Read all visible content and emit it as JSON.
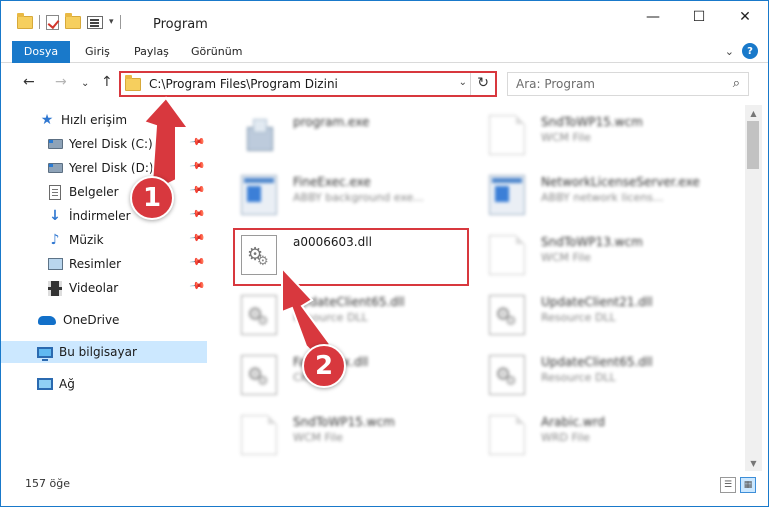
{
  "window": {
    "title": "Program",
    "minimize_glyph": "—",
    "maximize_glyph": "☐",
    "close_glyph": "✕"
  },
  "ribbon": {
    "tabs": [
      {
        "label": "Dosya"
      },
      {
        "label": "Giriş"
      },
      {
        "label": "Paylaş"
      },
      {
        "label": "Görünüm"
      }
    ],
    "expand_glyph": "⌄",
    "help_glyph": "?"
  },
  "nav": {
    "back_glyph": "←",
    "forward_glyph": "→",
    "recent_glyph": "⌄",
    "up_glyph": "↑"
  },
  "address": {
    "path": "C:\\Program Files\\Program Dizini",
    "dropdown_glyph": "⌄",
    "refresh_glyph": "↻"
  },
  "search": {
    "placeholder": "Ara: Program",
    "icon_glyph": "⌕"
  },
  "sidebar": {
    "items": [
      {
        "label": "Hızlı erişim",
        "icon": "star-icon"
      },
      {
        "label": "Yerel Disk (C:)",
        "icon": "disk-icon",
        "pinned": true
      },
      {
        "label": "Yerel Disk (D:)",
        "icon": "disk-icon",
        "pinned": true
      },
      {
        "label": "Belgeler",
        "icon": "document-icon",
        "pinned": true
      },
      {
        "label": "İndirmeler",
        "icon": "download-icon",
        "pinned": true
      },
      {
        "label": "Müzik",
        "icon": "music-icon",
        "pinned": true
      },
      {
        "label": "Resimler",
        "icon": "pictures-icon",
        "pinned": true
      },
      {
        "label": "Videolar",
        "icon": "video-icon",
        "pinned": true
      },
      {
        "label": "OneDrive",
        "icon": "cloud-icon"
      },
      {
        "label": "Bu bilgisayar",
        "icon": "computer-icon",
        "selected": true
      },
      {
        "label": "Ağ",
        "icon": "network-icon"
      }
    ],
    "pin_glyph": "📌",
    "star_glyph": "★",
    "download_glyph": "↓",
    "music_glyph": "♪"
  },
  "files": [
    {
      "name": "program.exe",
      "type": "",
      "icon": "setup-icon",
      "blurred": true
    },
    {
      "name": "SndToWP15.wcm",
      "type": "WCM File",
      "icon": "page-icon",
      "blurred": true
    },
    {
      "name": "FineExec.exe",
      "type": "ABBY background exe...",
      "icon": "app-icon",
      "blurred": true
    },
    {
      "name": "NetworkLicenseServer.exe",
      "type": "ABBY network licens...",
      "icon": "app-icon",
      "blurred": true
    },
    {
      "name": "a0006603.dll",
      "type": "",
      "icon": "gear-icon",
      "blurred": false
    },
    {
      "name": "SndToWP13.wcm",
      "type": "WCM File",
      "icon": "page-icon",
      "blurred": true
    },
    {
      "name": "UpdateClient65.dll",
      "type": "Resource DLL",
      "icon": "gear-icon",
      "blurred": true
    },
    {
      "name": "UpdateClient21.dll",
      "type": "Resource DLL",
      "icon": "gear-icon",
      "blurred": true
    },
    {
      "name": "FastIndex.dll",
      "type": "CK File",
      "icon": "gear-icon",
      "blurred": true
    },
    {
      "name": "UpdateClient65.dll",
      "type": "Resource DLL",
      "icon": "gear-icon",
      "blurred": true
    },
    {
      "name": "SndToWP15.wcm",
      "type": "WCM File",
      "icon": "page-icon",
      "blurred": true
    },
    {
      "name": "Arabic.wrd",
      "type": "WRD File",
      "icon": "page-icon",
      "blurred": true
    }
  ],
  "scrollbar": {
    "up_glyph": "▲",
    "down_glyph": "▼"
  },
  "status": {
    "count": "157 öğe",
    "details_view_glyph": "☰",
    "tiles_view_glyph": "▦"
  },
  "annotations": [
    {
      "number": "1"
    },
    {
      "number": "2"
    }
  ],
  "colors": {
    "accent": "#1979ca",
    "annotation_red": "#d8383e",
    "selected_bg": "#cce8ff"
  }
}
